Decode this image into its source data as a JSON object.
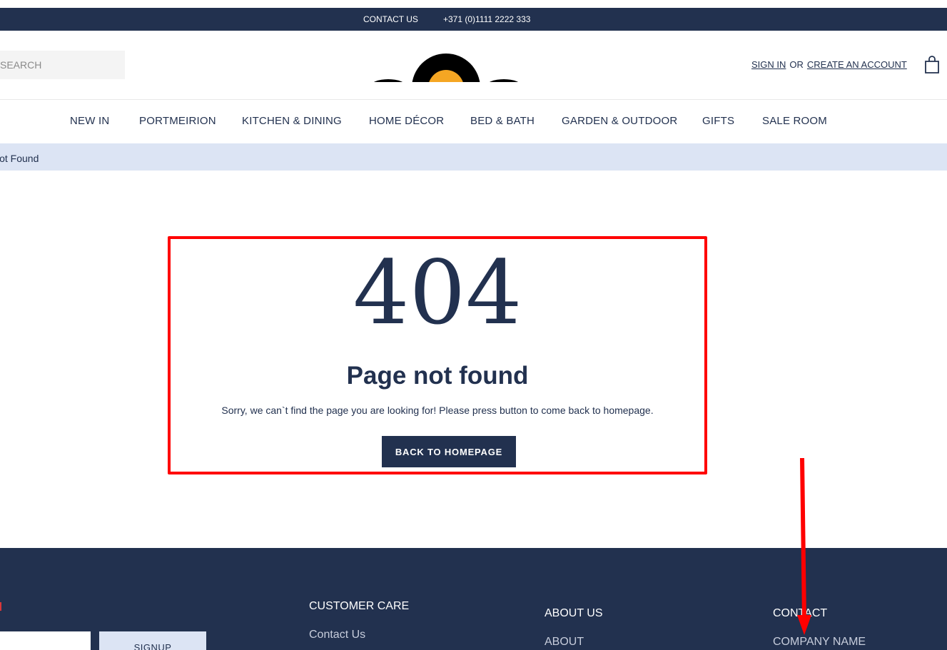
{
  "topbar": {
    "contact_label": "CONTACT US",
    "phone": "+371 (0)1111 2222 333"
  },
  "header": {
    "search_placeholder": "SEARCH",
    "sign_in": "SIGN IN",
    "or": "OR",
    "create_account": "CREATE AN ACCOUNT",
    "cart_icon": "shopping-bag-icon"
  },
  "nav": {
    "items": [
      "NEW IN",
      "PORTMEIRION",
      "KITCHEN & DINING",
      "HOME DÉCOR",
      "BED & BATH",
      "GARDEN & OUTDOOR",
      "GIFTS",
      "SALE ROOM"
    ]
  },
  "breadcrumb": {
    "current": "Not Found"
  },
  "error": {
    "code": "404",
    "title": "Page not found",
    "message": "Sorry, we can`t find the page you are looking for! Please press button to come back to homepage.",
    "button_label": "BACK TO HOMEPAGE"
  },
  "footer": {
    "newsletter_button": "SIGNUP",
    "customer_care": {
      "heading": "CUSTOMER CARE",
      "links": [
        "Contact Us"
      ]
    },
    "about": {
      "heading": "ABOUT US",
      "links": [
        "ABOUT"
      ]
    },
    "contact": {
      "heading": "CONTACT",
      "links": [
        "COMPANY NAME"
      ]
    }
  },
  "colors": {
    "navy": "#22314f",
    "breadcrumb_bg": "#dce4f4",
    "highlight": "#ff0000",
    "logo_accent": "#f5a623"
  }
}
